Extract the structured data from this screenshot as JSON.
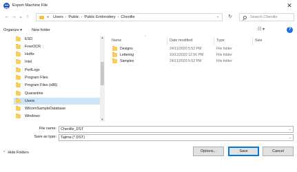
{
  "window": {
    "title": "Export Machine File",
    "close_glyph": "✕"
  },
  "nav": {
    "back_glyph": "←",
    "forward_glyph": "→",
    "recent_glyph": "⌄",
    "up_glyph": "↑",
    "breadcrumb_prefix": "«",
    "breadcrumbs": [
      "Users",
      "Public",
      "Public Embroidery",
      "Chenille"
    ],
    "crumb_separator": "›",
    "dropdown_glyph": "⌄",
    "refresh_glyph": "↻",
    "search_placeholder": "Search Chenille"
  },
  "toolbar": {
    "organize_label": "Organize ▾",
    "new_folder_label": "New folder",
    "view_glyph": "☷ ▾",
    "help_glyph": "?"
  },
  "sidebar": {
    "items": [
      {
        "label": "ESD",
        "selected": false
      },
      {
        "label": "FreeOCR",
        "selected": false
      },
      {
        "label": "Hotfix",
        "selected": false
      },
      {
        "label": "Intel",
        "selected": false
      },
      {
        "label": "PerfLogs",
        "selected": false
      },
      {
        "label": "Program Files",
        "selected": false
      },
      {
        "label": "Program Files (x86)",
        "selected": false
      },
      {
        "label": "Quarantine",
        "selected": false
      },
      {
        "label": "Users",
        "selected": true
      },
      {
        "label": "WilcomSampleDatabase",
        "selected": false
      },
      {
        "label": "Windows",
        "selected": false
      }
    ],
    "scroll_up_glyph": "▲",
    "scroll_down_glyph": "▼"
  },
  "filelist": {
    "columns": {
      "name": "Name",
      "date": "Date modified",
      "type": "Type",
      "size": "Size"
    },
    "sort_glyph": "^",
    "rows": [
      {
        "name": "Designs",
        "date": "24/11/2020 5:52 PM",
        "type": "File folder"
      },
      {
        "name": "Lettering",
        "date": "10/11/2020 12:56 PM",
        "type": "File folder"
      },
      {
        "name": "Samples",
        "date": "24/11/2020 5:52 PM",
        "type": "File folder"
      }
    ]
  },
  "fields": {
    "filename_label": "File name:",
    "filename_value": "Chenille_DST",
    "savetype_label": "Save as type:",
    "savetype_value": "Tajima (*.DST)",
    "dropdown_glyph": "⌄"
  },
  "footer": {
    "hide_folders_label": "Hide Folders",
    "caret_glyph": "^",
    "options_label": "Options...",
    "save_label": "Save",
    "cancel_label": "Cancel"
  },
  "colors": {
    "selection": "#cce4f7",
    "folder": "#f8ce5a",
    "accent": "#0078d7"
  }
}
